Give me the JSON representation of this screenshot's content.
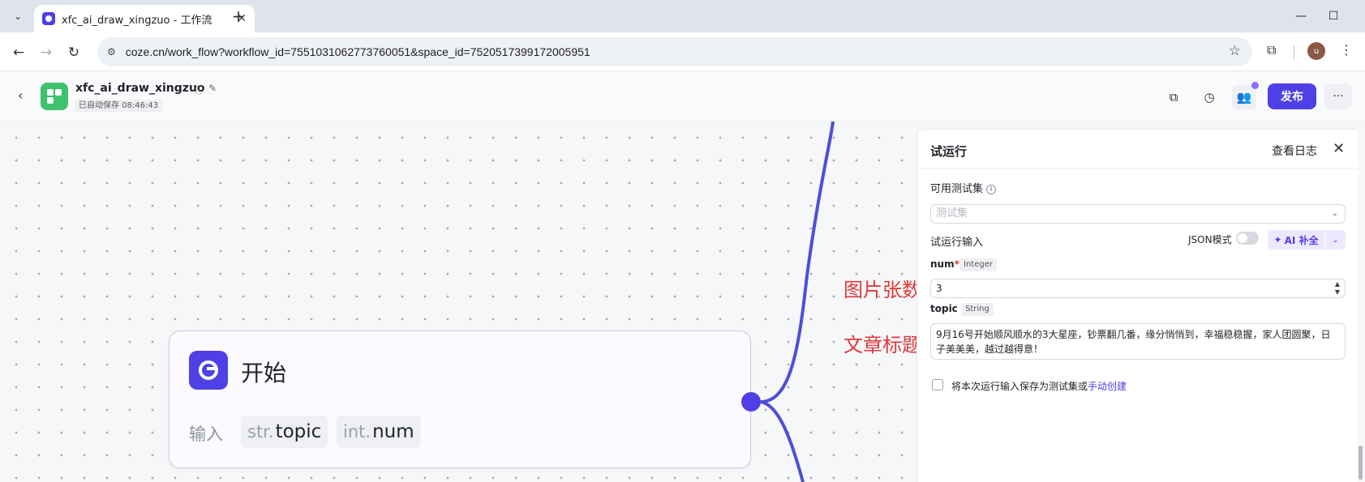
{
  "browser": {
    "tab_title": "xfc_ai_draw_xingzuo - 工作流",
    "url": "coze.cn/work_flow?workflow_id=7551031062773760051&space_id=7520517399172005951",
    "avatar_letter": "u"
  },
  "header": {
    "workflow_name": "xfc_ai_draw_xingzuo",
    "saved_status": "已自动保存 08:46:43",
    "publish_label": "发布"
  },
  "canvas": {
    "annotation_num": "图片张数",
    "annotation_topic": "文章标题",
    "start_node": {
      "title": "开始",
      "input_label": "输入",
      "params": [
        {
          "type": "str.",
          "name": "topic"
        },
        {
          "type": "int.",
          "name": "num"
        }
      ]
    }
  },
  "panel": {
    "title": "试运行",
    "view_log": "查看日志",
    "testset_label": "可用测试集",
    "testset_placeholder": "测试集",
    "run_input_label": "试运行输入",
    "json_mode_label": "JSON模式",
    "ai_fill_label": "AI 补全",
    "num": {
      "name": "num",
      "required_mark": "*",
      "type": "Integer",
      "value": "3"
    },
    "topic": {
      "name": "topic",
      "type": "String",
      "value": "9月16号开始顺风顺水的3大星座，钞票翻几番，缘分悄悄到，幸福稳稳握，家人团圆聚，日子美美美，越过越得意！"
    },
    "save_text": "将本次运行输入保存为测试集或",
    "save_link": "手动创建"
  },
  "colors": {
    "accent": "#4e40e5",
    "annotation": "#e0393a",
    "logo_green": "#3ec26e"
  }
}
